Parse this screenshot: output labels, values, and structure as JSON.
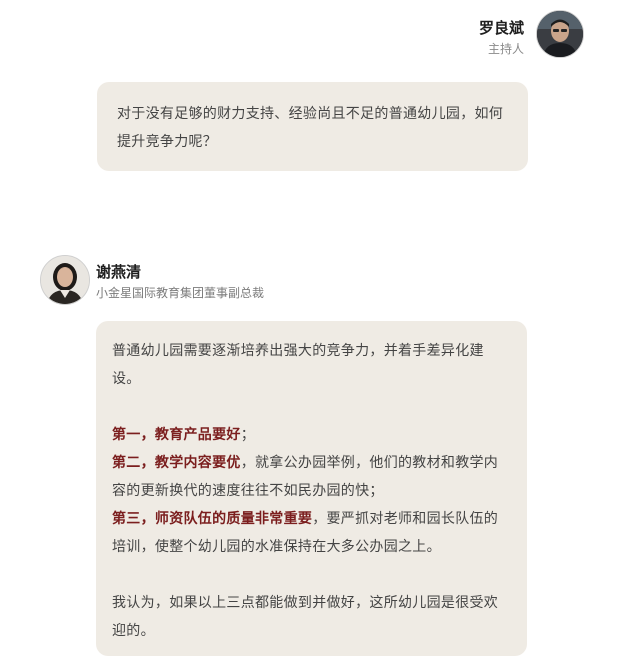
{
  "host": {
    "name": "罗良斌",
    "role": "主持人"
  },
  "question": "对于没有足够的财力支持、经验尚且不足的普通幼儿园，如何提升竞争力呢？",
  "guest": {
    "name": "谢燕清",
    "title": "小金星国际教育集团董事副总裁"
  },
  "answer": {
    "intro": "普通幼儿园需要逐渐培养出强大的竞争力，并着手差异化建设。",
    "point1_label": "第一，教育产品要好",
    "point1_text": "；",
    "point2_label": "第二，教学内容要优",
    "point2_text": "，就拿公办园举例，他们的教材和教学内容的更新换代的速度往往不如民办园的快；",
    "point3_label": "第三，师资队伍的质量非常重要",
    "point3_text": "，要严抓对老师和园长队伍的培训，使整个幼儿园的水准保持在大多公办园之上。",
    "conclusion": "我认为，如果以上三点都能做到并做好，这所幼儿园是很受欢迎的。"
  },
  "colors": {
    "bubble": "#efebe4",
    "highlight": "#7b1e1e"
  },
  "icons": {
    "host_avatar": "man-portrait-avatar",
    "guest_avatar": "woman-portrait-avatar"
  }
}
